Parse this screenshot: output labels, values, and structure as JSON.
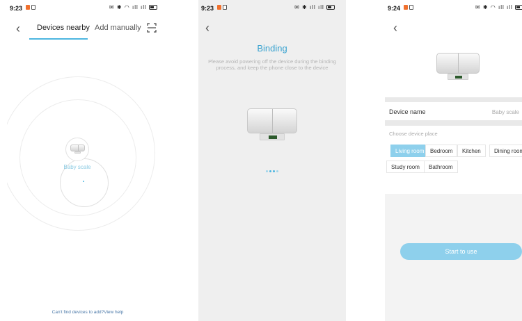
{
  "screens": [
    {
      "status": {
        "time": "9:23",
        "icons": "✉ ✱ ◠ ıll ıll"
      },
      "tabs": [
        {
          "label": "Devices nearby"
        },
        {
          "label": "Add manually"
        }
      ],
      "device_label": "Baby scale",
      "help_link": "Can't find devices to add?View help"
    },
    {
      "status": {
        "time": "9:23",
        "icons": "✉ ✱ ıll ıll"
      },
      "title": "Binding",
      "description": "Please avoid powering off the device during the binding process, and keep the phone close to the device"
    },
    {
      "status": {
        "time": "9:24",
        "icons": "✉ ✱ ◠ ıll ıll"
      },
      "device_name_label": "Device name",
      "device_name_value": "Baby scale",
      "place_title": "Choose device place",
      "places": [
        "Living room",
        "Bedroom",
        "Kitchen",
        "Dining room",
        "Study room",
        "Bathroom"
      ],
      "selected_place": "Living room",
      "start_button": "Start to use"
    }
  ],
  "colors": {
    "accent": "#4cb6e0",
    "button": "#8ed0ec",
    "notif": "#f0702d"
  }
}
